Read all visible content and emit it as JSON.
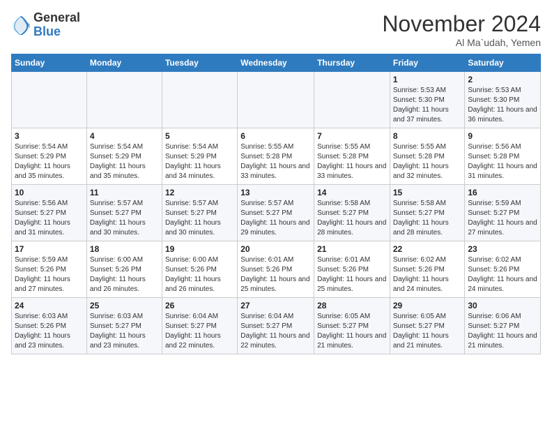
{
  "header": {
    "logo_line1": "General",
    "logo_line2": "Blue",
    "month_title": "November 2024",
    "subtitle": "Al Ma`udah, Yemen"
  },
  "weekdays": [
    "Sunday",
    "Monday",
    "Tuesday",
    "Wednesday",
    "Thursday",
    "Friday",
    "Saturday"
  ],
  "weeks": [
    [
      {
        "day": "",
        "sunrise": "",
        "sunset": "",
        "daylight": ""
      },
      {
        "day": "",
        "sunrise": "",
        "sunset": "",
        "daylight": ""
      },
      {
        "day": "",
        "sunrise": "",
        "sunset": "",
        "daylight": ""
      },
      {
        "day": "",
        "sunrise": "",
        "sunset": "",
        "daylight": ""
      },
      {
        "day": "",
        "sunrise": "",
        "sunset": "",
        "daylight": ""
      },
      {
        "day": "1",
        "sunrise": "Sunrise: 5:53 AM",
        "sunset": "Sunset: 5:30 PM",
        "daylight": "Daylight: 11 hours and 37 minutes."
      },
      {
        "day": "2",
        "sunrise": "Sunrise: 5:53 AM",
        "sunset": "Sunset: 5:30 PM",
        "daylight": "Daylight: 11 hours and 36 minutes."
      }
    ],
    [
      {
        "day": "3",
        "sunrise": "Sunrise: 5:54 AM",
        "sunset": "Sunset: 5:29 PM",
        "daylight": "Daylight: 11 hours and 35 minutes."
      },
      {
        "day": "4",
        "sunrise": "Sunrise: 5:54 AM",
        "sunset": "Sunset: 5:29 PM",
        "daylight": "Daylight: 11 hours and 35 minutes."
      },
      {
        "day": "5",
        "sunrise": "Sunrise: 5:54 AM",
        "sunset": "Sunset: 5:29 PM",
        "daylight": "Daylight: 11 hours and 34 minutes."
      },
      {
        "day": "6",
        "sunrise": "Sunrise: 5:55 AM",
        "sunset": "Sunset: 5:28 PM",
        "daylight": "Daylight: 11 hours and 33 minutes."
      },
      {
        "day": "7",
        "sunrise": "Sunrise: 5:55 AM",
        "sunset": "Sunset: 5:28 PM",
        "daylight": "Daylight: 11 hours and 33 minutes."
      },
      {
        "day": "8",
        "sunrise": "Sunrise: 5:55 AM",
        "sunset": "Sunset: 5:28 PM",
        "daylight": "Daylight: 11 hours and 32 minutes."
      },
      {
        "day": "9",
        "sunrise": "Sunrise: 5:56 AM",
        "sunset": "Sunset: 5:28 PM",
        "daylight": "Daylight: 11 hours and 31 minutes."
      }
    ],
    [
      {
        "day": "10",
        "sunrise": "Sunrise: 5:56 AM",
        "sunset": "Sunset: 5:27 PM",
        "daylight": "Daylight: 11 hours and 31 minutes."
      },
      {
        "day": "11",
        "sunrise": "Sunrise: 5:57 AM",
        "sunset": "Sunset: 5:27 PM",
        "daylight": "Daylight: 11 hours and 30 minutes."
      },
      {
        "day": "12",
        "sunrise": "Sunrise: 5:57 AM",
        "sunset": "Sunset: 5:27 PM",
        "daylight": "Daylight: 11 hours and 30 minutes."
      },
      {
        "day": "13",
        "sunrise": "Sunrise: 5:57 AM",
        "sunset": "Sunset: 5:27 PM",
        "daylight": "Daylight: 11 hours and 29 minutes."
      },
      {
        "day": "14",
        "sunrise": "Sunrise: 5:58 AM",
        "sunset": "Sunset: 5:27 PM",
        "daylight": "Daylight: 11 hours and 28 minutes."
      },
      {
        "day": "15",
        "sunrise": "Sunrise: 5:58 AM",
        "sunset": "Sunset: 5:27 PM",
        "daylight": "Daylight: 11 hours and 28 minutes."
      },
      {
        "day": "16",
        "sunrise": "Sunrise: 5:59 AM",
        "sunset": "Sunset: 5:27 PM",
        "daylight": "Daylight: 11 hours and 27 minutes."
      }
    ],
    [
      {
        "day": "17",
        "sunrise": "Sunrise: 5:59 AM",
        "sunset": "Sunset: 5:26 PM",
        "daylight": "Daylight: 11 hours and 27 minutes."
      },
      {
        "day": "18",
        "sunrise": "Sunrise: 6:00 AM",
        "sunset": "Sunset: 5:26 PM",
        "daylight": "Daylight: 11 hours and 26 minutes."
      },
      {
        "day": "19",
        "sunrise": "Sunrise: 6:00 AM",
        "sunset": "Sunset: 5:26 PM",
        "daylight": "Daylight: 11 hours and 26 minutes."
      },
      {
        "day": "20",
        "sunrise": "Sunrise: 6:01 AM",
        "sunset": "Sunset: 5:26 PM",
        "daylight": "Daylight: 11 hours and 25 minutes."
      },
      {
        "day": "21",
        "sunrise": "Sunrise: 6:01 AM",
        "sunset": "Sunset: 5:26 PM",
        "daylight": "Daylight: 11 hours and 25 minutes."
      },
      {
        "day": "22",
        "sunrise": "Sunrise: 6:02 AM",
        "sunset": "Sunset: 5:26 PM",
        "daylight": "Daylight: 11 hours and 24 minutes."
      },
      {
        "day": "23",
        "sunrise": "Sunrise: 6:02 AM",
        "sunset": "Sunset: 5:26 PM",
        "daylight": "Daylight: 11 hours and 24 minutes."
      }
    ],
    [
      {
        "day": "24",
        "sunrise": "Sunrise: 6:03 AM",
        "sunset": "Sunset: 5:26 PM",
        "daylight": "Daylight: 11 hours and 23 minutes."
      },
      {
        "day": "25",
        "sunrise": "Sunrise: 6:03 AM",
        "sunset": "Sunset: 5:27 PM",
        "daylight": "Daylight: 11 hours and 23 minutes."
      },
      {
        "day": "26",
        "sunrise": "Sunrise: 6:04 AM",
        "sunset": "Sunset: 5:27 PM",
        "daylight": "Daylight: 11 hours and 22 minutes."
      },
      {
        "day": "27",
        "sunrise": "Sunrise: 6:04 AM",
        "sunset": "Sunset: 5:27 PM",
        "daylight": "Daylight: 11 hours and 22 minutes."
      },
      {
        "day": "28",
        "sunrise": "Sunrise: 6:05 AM",
        "sunset": "Sunset: 5:27 PM",
        "daylight": "Daylight: 11 hours and 21 minutes."
      },
      {
        "day": "29",
        "sunrise": "Sunrise: 6:05 AM",
        "sunset": "Sunset: 5:27 PM",
        "daylight": "Daylight: 11 hours and 21 minutes."
      },
      {
        "day": "30",
        "sunrise": "Sunrise: 6:06 AM",
        "sunset": "Sunset: 5:27 PM",
        "daylight": "Daylight: 11 hours and 21 minutes."
      }
    ]
  ]
}
